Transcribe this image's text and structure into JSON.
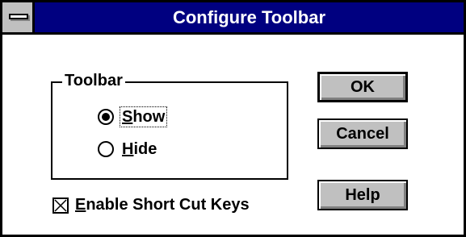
{
  "window": {
    "title": "Configure Toolbar"
  },
  "toolbar_group": {
    "label": "Toolbar",
    "options": [
      {
        "label": "Show",
        "selected": true
      },
      {
        "label": "Hide",
        "selected": false
      }
    ]
  },
  "shortcut_checkbox": {
    "label": "Enable Short Cut Keys",
    "checked": true
  },
  "buttons": {
    "ok": "OK",
    "cancel": "Cancel",
    "help": "Help"
  },
  "colors": {
    "titlebar": "#000080",
    "button_face": "#c0c0c0",
    "background": "#ffffff"
  },
  "icons": {
    "system_menu": "system-menu-icon",
    "radio_selected": "radio-selected-icon",
    "radio_unselected": "radio-unselected-icon",
    "checkbox_checked": "checkbox-x-icon"
  }
}
